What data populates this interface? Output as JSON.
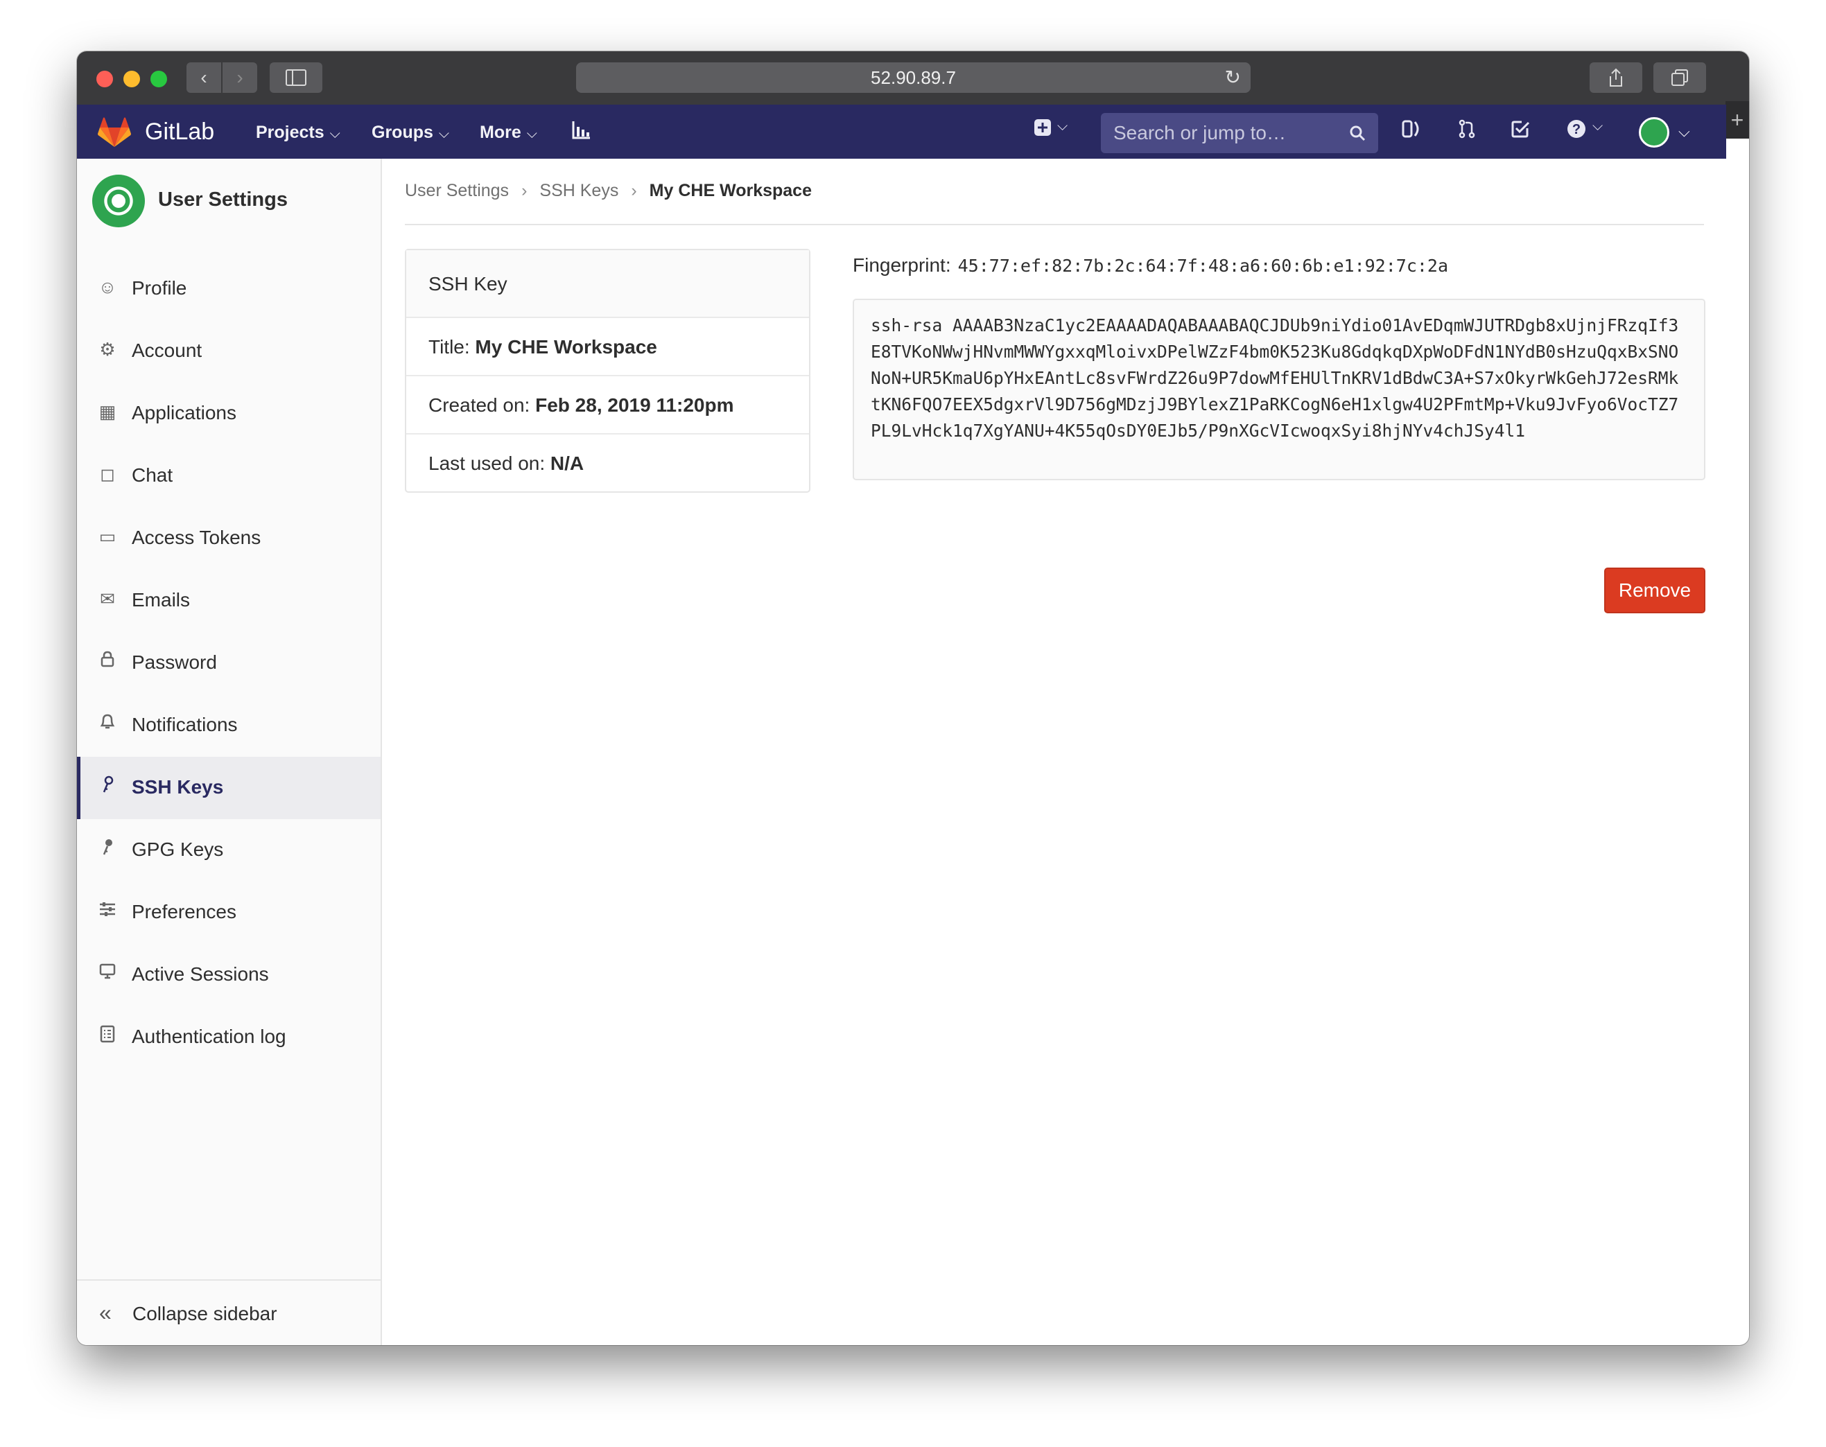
{
  "browser": {
    "address": "52.90.89.7"
  },
  "navbar": {
    "brand": "GitLab",
    "projects": "Projects",
    "groups": "Groups",
    "more": "More",
    "search_placeholder": "Search or jump to…"
  },
  "sidebar": {
    "title": "User Settings",
    "items": [
      {
        "label": "Profile",
        "icon": "profile-icon"
      },
      {
        "label": "Account",
        "icon": "account-icon"
      },
      {
        "label": "Applications",
        "icon": "applications-icon"
      },
      {
        "label": "Chat",
        "icon": "chat-icon"
      },
      {
        "label": "Access Tokens",
        "icon": "access-tokens-icon"
      },
      {
        "label": "Emails",
        "icon": "email-icon"
      },
      {
        "label": "Password",
        "icon": "lock-icon"
      },
      {
        "label": "Notifications",
        "icon": "bell-icon"
      },
      {
        "label": "SSH Keys",
        "icon": "key-icon",
        "active": true
      },
      {
        "label": "GPG Keys",
        "icon": "key-icon"
      },
      {
        "label": "Preferences",
        "icon": "preferences-icon"
      },
      {
        "label": "Active Sessions",
        "icon": "monitor-icon"
      },
      {
        "label": "Authentication log",
        "icon": "log-icon"
      }
    ],
    "collapse": "Collapse sidebar"
  },
  "breadcrumb": {
    "items": [
      "User Settings",
      "SSH Keys"
    ],
    "current": "My CHE Workspace"
  },
  "key_card": {
    "header": "SSH Key",
    "title_label": "Title:",
    "title_value": "My CHE Workspace",
    "created_label": "Created on:",
    "created_value": "Feb 28, 2019 11:20pm",
    "last_used_label": "Last used on:",
    "last_used_value": "N/A"
  },
  "fingerprint": {
    "label": "Fingerprint:",
    "value": "45:77:ef:82:7b:2c:64:7f:48:a6:60:6b:e1:92:7c:2a"
  },
  "public_key": "ssh-rsa AAAAB3NzaC1yc2EAAAADAQABAAABAQCJDUb9niYdio01AvEDqmWJUTRDgb8xUjnjFRzqIf3E8TVKoNWwjHNvmMWWYgxxqMloivxDPelWZzF4bm0K523Ku8GdqkqDXpWoDFdN1NYdB0sHzuQqxBxSNONoN+UR5KmaU6pYHxEAntLc8svFWrdZ26u9P7dowMfEHUlTnKRV1dBdwC3A+S7xOkyrWkGehJ72esRMktKN6FQO7EEX5dgxrVl9D756gMDzjJ9BYlexZ1PaRKCogN6eH1xlgw4U2PFmtMp+Vku9JvFyo6VocTZ7PL9LvHck1q7XgYANU+4K55qOsDY0EJb5/P9nXGcVIcwoqxSyi8hjNYv4chJSy4l1",
  "actions": {
    "remove": "Remove"
  },
  "colors": {
    "navbar": "#292961",
    "remove": "#db3b21"
  }
}
